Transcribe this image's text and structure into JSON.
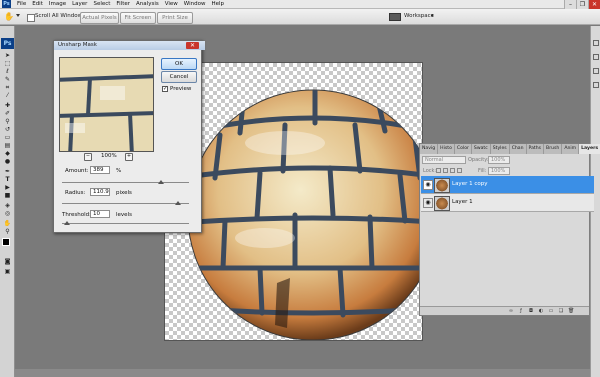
{
  "menu": {
    "app_badge": "Ps",
    "items": [
      "File",
      "Edit",
      "Image",
      "Layer",
      "Select",
      "Filter",
      "Analysis",
      "View",
      "Window",
      "Help"
    ]
  },
  "options_bar": {
    "scroll_all_windows": "Scroll All Windows",
    "actual_pixels": "Actual Pixels",
    "fit_screen": "Fit Screen",
    "print_size": "Print Size",
    "workspace": "Workspace"
  },
  "toolbar": {
    "logo": "Ps"
  },
  "dialog": {
    "title": "Unsharp Mask",
    "ok": "OK",
    "cancel": "Cancel",
    "preview_label": "Preview",
    "preview_checked": true,
    "zoom": "100%",
    "amount_label": "Amount:",
    "amount_value": "389",
    "amount_unit": "%",
    "amount_fraction": 0.78,
    "radius_label": "Radius:",
    "radius_value": "110.9",
    "radius_unit": "pixels",
    "radius_fraction": 0.91,
    "threshold_label": "Threshold:",
    "threshold_value": "10",
    "threshold_unit": "levels",
    "threshold_fraction": 0.04
  },
  "layers_panel": {
    "tabs": [
      "Navig",
      "Histo",
      "Color",
      "Swatc",
      "Styles",
      "Chan",
      "Paths",
      "Brush",
      "Anim",
      "Layers"
    ],
    "active_tab": "Layers",
    "blend_mode": "Normal",
    "opacity_label": "Opacity:",
    "opacity_value": "100%",
    "lock_label": "Lock:",
    "fill_label": "Fill:",
    "fill_value": "100%",
    "layers": [
      {
        "name": "Layer 1 copy",
        "selected": true
      },
      {
        "name": "Layer 1",
        "selected": false
      }
    ]
  },
  "colors": {
    "selection": "#3b8fe6",
    "ps_blue": "#0b3f87",
    "close_red": "#c9352b"
  }
}
